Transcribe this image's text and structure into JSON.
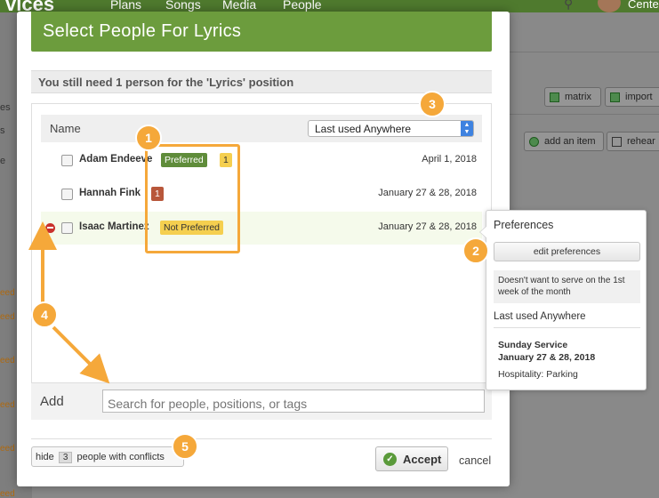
{
  "background": {
    "brand": "vices",
    "nav": [
      "Plans",
      "Songs",
      "Media",
      "People"
    ],
    "user_label": "Cente",
    "left_labels": [
      "es",
      "s",
      "e"
    ],
    "need_label": "eed",
    "right_buttons": {
      "matrix": "matrix",
      "import": "import",
      "add_item": "add an item",
      "rehearse": "rehear"
    }
  },
  "modal": {
    "title": "Select People For Lyrics",
    "notice": "You still need 1 person for the 'Lyrics' position",
    "list_header": {
      "name": "Name",
      "sort_value": "Last used Anywhere"
    },
    "people": [
      {
        "name": "Adam Endeeve",
        "badge": "Preferred",
        "count": "1",
        "date": "April 1, 2018"
      },
      {
        "name": "Hannah Fink",
        "count": "1",
        "date": "January 27 & 28, 2018"
      },
      {
        "name": "Isaac Martinez",
        "badge": "Not Preferred",
        "date": "January 27 & 28, 2018"
      }
    ],
    "add": {
      "label": "Add",
      "placeholder": "Search for people, positions, or tags"
    },
    "hide_conflicts": {
      "prefix": "hide",
      "count": "3",
      "suffix": "people with conflicts"
    },
    "accept_label": "Accept",
    "cancel_label": "cancel"
  },
  "popover": {
    "title": "Preferences",
    "edit_button": "edit preferences",
    "note": "Doesn't want to serve on the 1st week of the month",
    "section_title": "Last used Anywhere",
    "service_name": "Sunday Service",
    "service_date": "January 27 & 28, 2018",
    "service_position": "Hospitality: Parking"
  },
  "annotations": [
    "1",
    "2",
    "3",
    "4",
    "5"
  ],
  "colors": {
    "header_green": "#6c9c3d",
    "annotation_orange": "#f5a83a",
    "preferred_green": "#5f8c3a",
    "badge_yellow": "#f5cf4f",
    "badge_red": "#b8573b",
    "remove_red": "#c9302c"
  }
}
